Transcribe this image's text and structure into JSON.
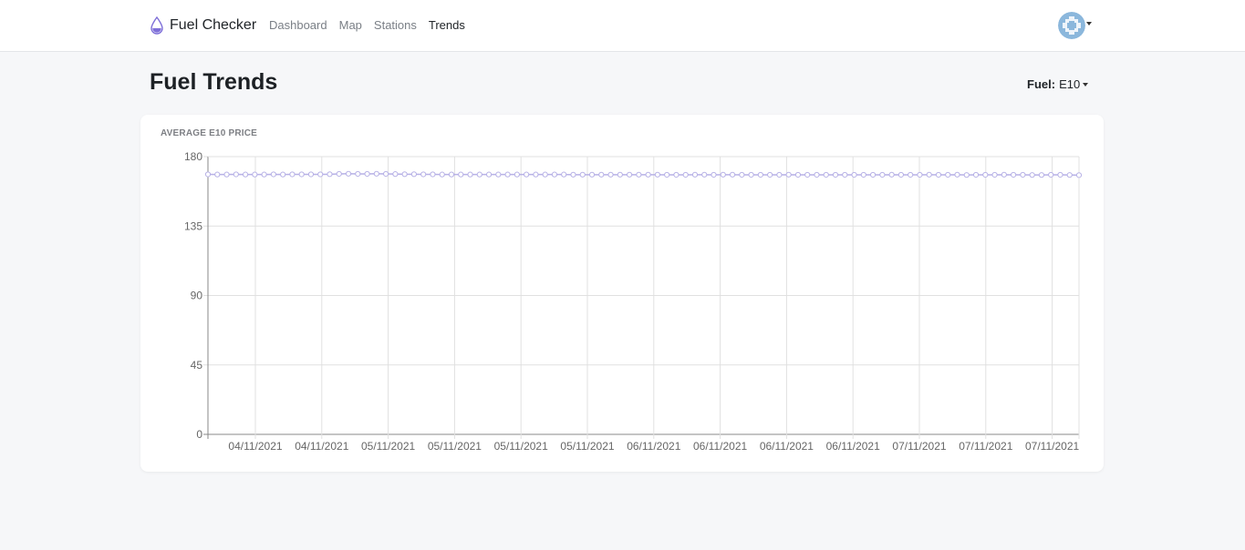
{
  "nav": {
    "brand": "Fuel Checker",
    "links": [
      {
        "label": "Dashboard",
        "active": false
      },
      {
        "label": "Map",
        "active": false
      },
      {
        "label": "Stations",
        "active": false
      },
      {
        "label": "Trends",
        "active": true
      }
    ],
    "brand_color": "#7e6fd8"
  },
  "page": {
    "title": "Fuel Trends",
    "fuel_label": "Fuel:",
    "fuel_value": "E10"
  },
  "card": {
    "title": "AVERAGE E10 PRICE"
  },
  "chart_data": {
    "type": "line",
    "title": "AVERAGE E10 PRICE",
    "xlabel": "",
    "ylabel": "",
    "ylim": [
      0,
      180
    ],
    "yticks": [
      0,
      45,
      90,
      135,
      180
    ],
    "xtick_labels": [
      "04/11/2021",
      "04/11/2021",
      "05/11/2021",
      "05/11/2021",
      "05/11/2021",
      "05/11/2021",
      "06/11/2021",
      "06/11/2021",
      "06/11/2021",
      "06/11/2021",
      "07/11/2021",
      "07/11/2021",
      "07/11/2021"
    ],
    "grid": true,
    "legend": "none",
    "line_color": "#b7b1e6",
    "series": [
      {
        "values": [
          168.5,
          168.4,
          168.4,
          168.5,
          168.4,
          168.4,
          168.4,
          168.5,
          168.4,
          168.5,
          168.5,
          168.5,
          168.5,
          168.6,
          168.8,
          168.9,
          168.8,
          168.8,
          168.9,
          168.8,
          168.7,
          168.6,
          168.6,
          168.5,
          168.5,
          168.4,
          168.4,
          168.4,
          168.4,
          168.4,
          168.4,
          168.4,
          168.4,
          168.4,
          168.4,
          168.4,
          168.4,
          168.4,
          168.4,
          168.3,
          168.3,
          168.3,
          168.3,
          168.3,
          168.3,
          168.3,
          168.3,
          168.3,
          168.3,
          168.2,
          168.2,
          168.2,
          168.3,
          168.3,
          168.2,
          168.3,
          168.3,
          168.2,
          168.2,
          168.2,
          168.2,
          168.2,
          168.3,
          168.2,
          168.2,
          168.2,
          168.2,
          168.2,
          168.2,
          168.2,
          168.2,
          168.2,
          168.2,
          168.3,
          168.2,
          168.2,
          168.2,
          168.3,
          168.2,
          168.2,
          168.3,
          168.1,
          168.2,
          168.2,
          168.2,
          168.3,
          168.2,
          168.2,
          168.1,
          168.1,
          168.2,
          168.2,
          168.1,
          168.0
        ]
      }
    ]
  }
}
